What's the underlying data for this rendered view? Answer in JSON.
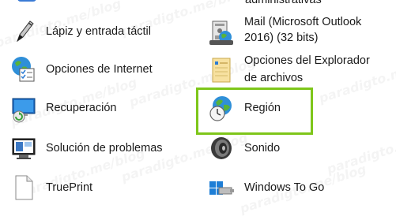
{
  "items": [
    {
      "label": "Lápiz y entrada táctil",
      "icon": "pen-icon"
    },
    {
      "label": "Opciones de Internet",
      "icon": "globe-checklist-icon"
    },
    {
      "label": "Recuperación",
      "icon": "recovery-monitor-icon"
    },
    {
      "label": "Solución de problemas",
      "icon": "troubleshoot-icon"
    },
    {
      "label": "TruePrint",
      "icon": "blank-document-icon"
    },
    {
      "label_line1": "administrativas",
      "icon": "admin-tools-icon"
    },
    {
      "label_line1": "Mail (Microsoft Outlook",
      "label_line2": "2016) (32 bits)",
      "icon": "mail-icon"
    },
    {
      "label_line1": "Opciones del Explorador",
      "label_line2": "de archivos",
      "icon": "folder-options-icon"
    },
    {
      "label": "Región",
      "icon": "globe-clock-icon"
    },
    {
      "label": "Sonido",
      "icon": "speaker-icon"
    },
    {
      "label": "Windows To Go",
      "icon": "usb-drive-icon"
    }
  ],
  "watermark": "paradigto.me/blog",
  "colors": {
    "highlight": "#7ec61a",
    "text": "#1a1a1a"
  }
}
